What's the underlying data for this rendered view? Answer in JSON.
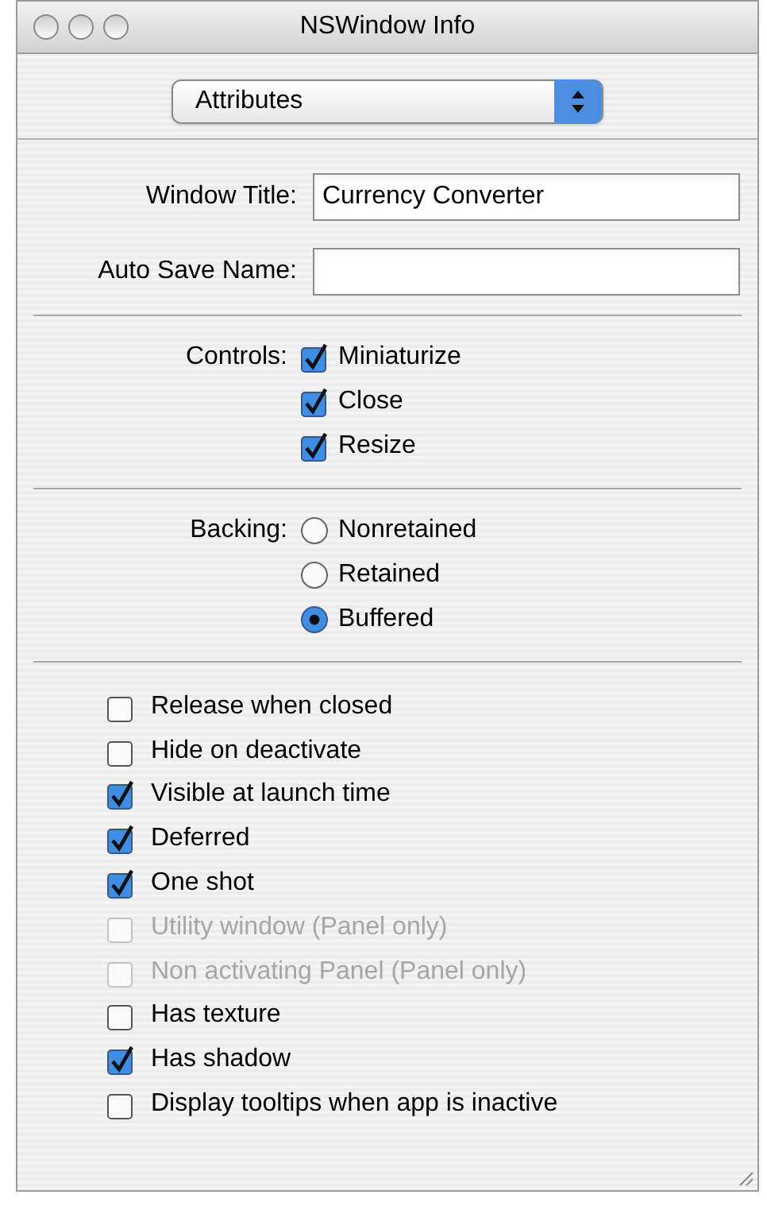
{
  "window": {
    "title": "NSWindow Info"
  },
  "popup": {
    "value": "Attributes"
  },
  "fields": [
    {
      "label": "Window Title:",
      "value": "Currency Converter"
    },
    {
      "label": "Auto Save Name:"
    }
  ],
  "controls": {
    "label": "Controls:",
    "items": [
      {
        "label": "Miniaturize",
        "checked": true
      },
      {
        "label": "Close",
        "checked": true
      },
      {
        "label": "Resize",
        "checked": true
      }
    ]
  },
  "backing": {
    "label": "Backing:",
    "options": [
      {
        "label": "Nonretained",
        "selected": false
      },
      {
        "label": "Retained",
        "selected": false
      },
      {
        "label": "Buffered",
        "selected": true
      }
    ]
  },
  "options": [
    {
      "label": "Release when closed",
      "checked": false,
      "disabled": false
    },
    {
      "label": "Hide on deactivate",
      "checked": false,
      "disabled": false
    },
    {
      "label": "Visible at launch time",
      "checked": true,
      "disabled": false
    },
    {
      "label": "Deferred",
      "checked": true,
      "disabled": false
    },
    {
      "label": "One shot",
      "checked": true,
      "disabled": false
    },
    {
      "label": "Utility window (Panel only)",
      "checked": false,
      "disabled": true
    },
    {
      "label": "Non activating Panel (Panel only)",
      "checked": false,
      "disabled": true
    },
    {
      "label": "Has texture",
      "checked": false,
      "disabled": false
    },
    {
      "label": "Has shadow",
      "checked": true,
      "disabled": false
    },
    {
      "label": "Display tooltips when app is inactive",
      "checked": false,
      "disabled": false
    }
  ]
}
